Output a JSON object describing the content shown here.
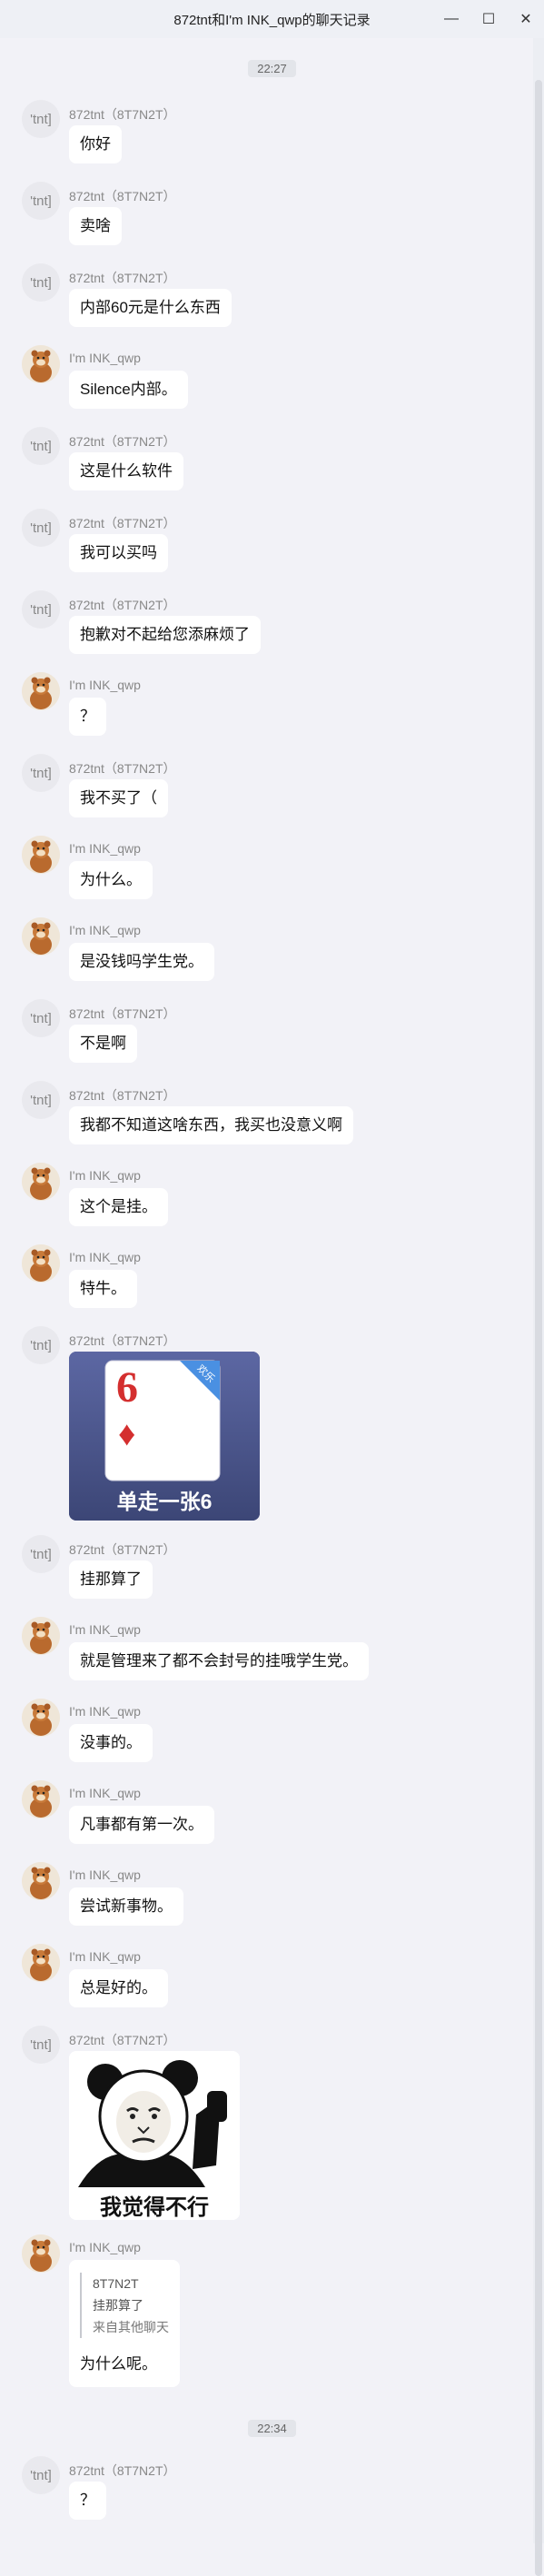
{
  "window": {
    "title": "872tnt和I'm INK_qwp的聊天记录",
    "min_glyph": "—",
    "max_glyph": "☐",
    "close_glyph": "✕"
  },
  "time_separators": [
    "22:27",
    "22:34"
  ],
  "avatar_tnt_text": "'tnt]",
  "senders": {
    "tnt": "872tnt（8T7N2T）",
    "ink": "I'm INK_qwp"
  },
  "messages": [
    {
      "from": "tnt",
      "text": "你好"
    },
    {
      "from": "tnt",
      "text": "卖啥"
    },
    {
      "from": "tnt",
      "text": "内部60元是什么东西"
    },
    {
      "from": "ink",
      "text": "Silence内部。"
    },
    {
      "from": "tnt",
      "text": "这是什么软件"
    },
    {
      "from": "tnt",
      "text": "我可以买吗"
    },
    {
      "from": "tnt",
      "text": "抱歉对不起给您添麻烦了"
    },
    {
      "from": "ink",
      "text": "？"
    },
    {
      "from": "tnt",
      "text": "我不买了（"
    },
    {
      "from": "ink",
      "text": "为什么。"
    },
    {
      "from": "ink",
      "text": "是没钱吗学生党。"
    },
    {
      "from": "tnt",
      "text": "不是啊"
    },
    {
      "from": "tnt",
      "text": "我都不知道这啥东西，我买也没意义啊"
    },
    {
      "from": "ink",
      "text": "这个是挂。"
    },
    {
      "from": "ink",
      "text": "特牛。"
    },
    {
      "from": "tnt",
      "image": "card",
      "card_rank": "6",
      "card_suit": "♦",
      "card_badge": "欢乐",
      "card_caption": "单走一张6"
    },
    {
      "from": "tnt",
      "text": "挂那算了"
    },
    {
      "from": "ink",
      "text": "就是管理来了都不会封号的挂哦学生党。"
    },
    {
      "from": "ink",
      "text": "没事的。"
    },
    {
      "from": "ink",
      "text": "凡事都有第一次。"
    },
    {
      "from": "ink",
      "text": "尝试新事物。"
    },
    {
      "from": "ink",
      "text": "总是好的。"
    },
    {
      "from": "tnt",
      "image": "meme",
      "meme_caption": "我觉得不行"
    },
    {
      "from": "ink",
      "quote": {
        "name": "8T7N2T",
        "text": "挂那算了",
        "note": "来自其他聊天"
      },
      "text": "为什么呢。"
    },
    {
      "from": "tnt",
      "text": "？"
    }
  ]
}
